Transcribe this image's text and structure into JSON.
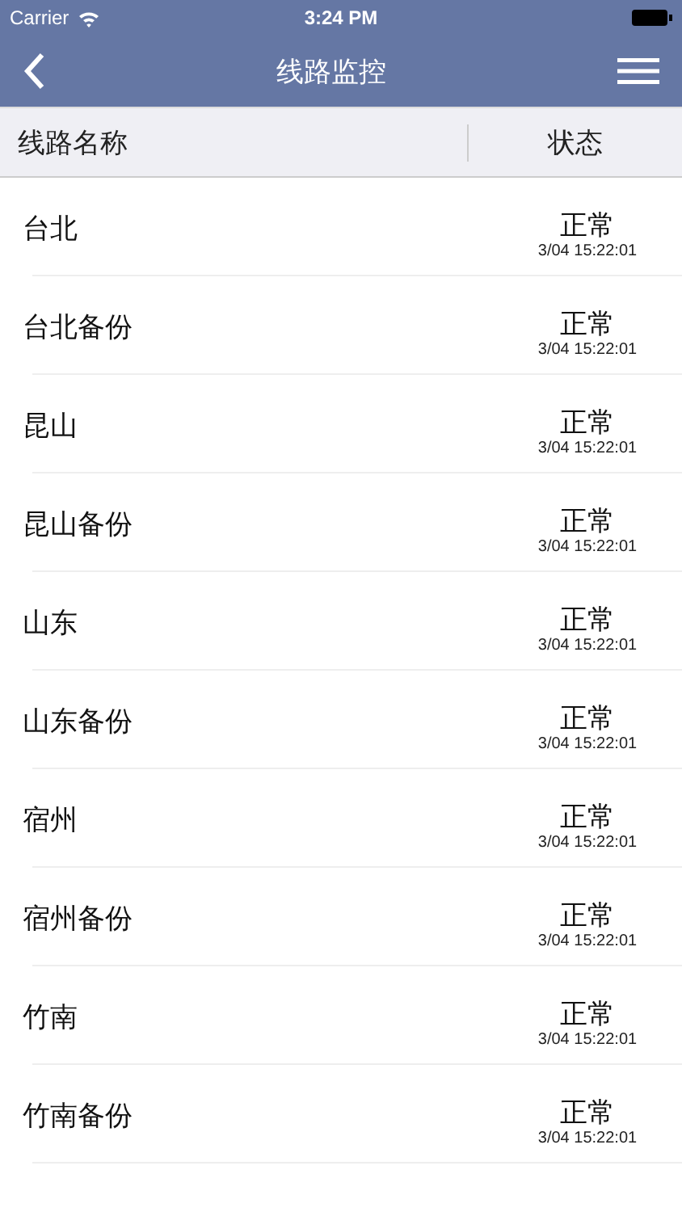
{
  "status_bar": {
    "carrier": "Carrier",
    "time": "3:24 PM"
  },
  "nav": {
    "title": "线路监控"
  },
  "table": {
    "columns": [
      "线路名称",
      "状态"
    ],
    "rows": [
      {
        "name": "台北",
        "status": "正常",
        "time": "3/04 15:22:01"
      },
      {
        "name": "台北备份",
        "status": "正常",
        "time": "3/04 15:22:01"
      },
      {
        "name": "昆山",
        "status": "正常",
        "time": "3/04 15:22:01"
      },
      {
        "name": "昆山备份",
        "status": "正常",
        "time": "3/04 15:22:01"
      },
      {
        "name": "山东",
        "status": "正常",
        "time": "3/04 15:22:01"
      },
      {
        "name": "山东备份",
        "status": "正常",
        "time": "3/04 15:22:01"
      },
      {
        "name": "宿州",
        "status": "正常",
        "time": "3/04 15:22:01"
      },
      {
        "name": "宿州备份",
        "status": "正常",
        "time": "3/04 15:22:01"
      },
      {
        "name": "竹南",
        "status": "正常",
        "time": "3/04 15:22:01"
      },
      {
        "name": "竹南备份",
        "status": "正常",
        "time": "3/04 15:22:01"
      }
    ]
  }
}
